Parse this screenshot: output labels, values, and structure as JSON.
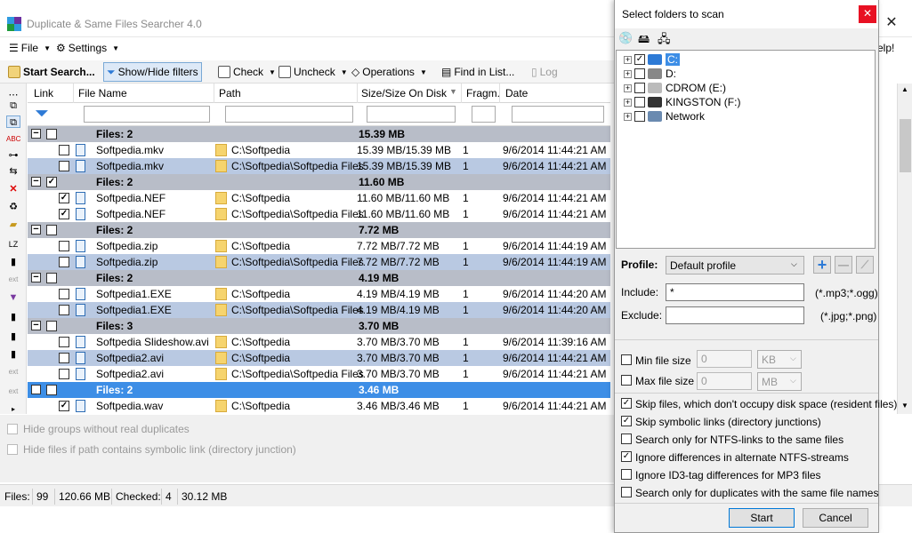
{
  "window": {
    "title": "Duplicate & Same Files Searcher 4.0",
    "close": "✕",
    "help_menu": "elp!"
  },
  "menu": {
    "file": "File",
    "settings": "Settings"
  },
  "toolbar": {
    "start_search": "Start Search...",
    "show_hide_filters": "Show/Hide filters",
    "check": "Check",
    "uncheck": "Uncheck",
    "operations": "Operations",
    "find_in_list": "Find in List...",
    "log": "Log"
  },
  "grid": {
    "headers": {
      "link": "Link",
      "file_name": "File Name",
      "path": "Path",
      "size": "Size/Size On Disk",
      "fragm": "Fragm.",
      "date": "Date"
    },
    "rows": [
      {
        "type": "group",
        "label": "Files: 2",
        "size": "15.39 MB",
        "checked": false
      },
      {
        "type": "file",
        "name": "Softpedia.mkv",
        "path": "C:\\Softpedia",
        "size": "15.39 MB/15.39 MB",
        "fragm": "1",
        "date": "9/6/2014 11:44:21 AM",
        "checked": false,
        "shade": "white"
      },
      {
        "type": "file",
        "name": "Softpedia.mkv",
        "path": "C:\\Softpedia\\Softpedia Files",
        "size": "15.39 MB/15.39 MB",
        "fragm": "1",
        "date": "9/6/2014 11:44:21 AM",
        "checked": false,
        "shade": "blue"
      },
      {
        "type": "group",
        "label": "Files: 2",
        "size": "11.60 MB",
        "checked": true
      },
      {
        "type": "file",
        "name": "Softpedia.NEF",
        "path": "C:\\Softpedia",
        "size": "11.60 MB/11.60 MB",
        "fragm": "1",
        "date": "9/6/2014 11:44:21 AM",
        "checked": true,
        "shade": "white"
      },
      {
        "type": "file",
        "name": "Softpedia.NEF",
        "path": "C:\\Softpedia\\Softpedia Files",
        "size": "11.60 MB/11.60 MB",
        "fragm": "1",
        "date": "9/6/2014 11:44:21 AM",
        "checked": true,
        "shade": "white"
      },
      {
        "type": "group",
        "label": "Files: 2",
        "size": "7.72 MB",
        "checked": false
      },
      {
        "type": "file",
        "name": "Softpedia.zip",
        "path": "C:\\Softpedia",
        "size": "7.72 MB/7.72 MB",
        "fragm": "1",
        "date": "9/6/2014 11:44:19 AM",
        "checked": false,
        "shade": "white"
      },
      {
        "type": "file",
        "name": "Softpedia.zip",
        "path": "C:\\Softpedia\\Softpedia Files",
        "size": "7.72 MB/7.72 MB",
        "fragm": "1",
        "date": "9/6/2014 11:44:19 AM",
        "checked": false,
        "shade": "blue"
      },
      {
        "type": "group",
        "label": "Files: 2",
        "size": "4.19 MB",
        "checked": false
      },
      {
        "type": "file",
        "name": "Softpedia1.EXE",
        "path": "C:\\Softpedia",
        "size": "4.19 MB/4.19 MB",
        "fragm": "1",
        "date": "9/6/2014 11:44:20 AM",
        "checked": false,
        "shade": "white"
      },
      {
        "type": "file",
        "name": "Softpedia1.EXE",
        "path": "C:\\Softpedia\\Softpedia Files",
        "size": "4.19 MB/4.19 MB",
        "fragm": "1",
        "date": "9/6/2014 11:44:20 AM",
        "checked": false,
        "shade": "blue"
      },
      {
        "type": "group",
        "label": "Files: 3",
        "size": "3.70 MB",
        "checked": false
      },
      {
        "type": "file",
        "name": "Softpedia Slideshow.avi",
        "path": "C:\\Softpedia",
        "size": "3.70 MB/3.70 MB",
        "fragm": "1",
        "date": "9/6/2014 11:39:16 AM",
        "checked": false,
        "shade": "white"
      },
      {
        "type": "file",
        "name": "Softpedia2.avi",
        "path": "C:\\Softpedia",
        "size": "3.70 MB/3.70 MB",
        "fragm": "1",
        "date": "9/6/2014 11:44:21 AM",
        "checked": false,
        "shade": "blue"
      },
      {
        "type": "file",
        "name": "Softpedia2.avi",
        "path": "C:\\Softpedia\\Softpedia Files",
        "size": "3.70 MB/3.70 MB",
        "fragm": "1",
        "date": "9/6/2014 11:44:21 AM",
        "checked": false,
        "shade": "white"
      },
      {
        "type": "group",
        "label": "Files: 2",
        "size": "3.46 MB",
        "checked": true,
        "selected": true
      },
      {
        "type": "file",
        "name": "Softpedia.wav",
        "path": "C:\\Softpedia",
        "size": "3.46 MB/3.46 MB",
        "fragm": "1",
        "date": "9/6/2014 11:44:21 AM",
        "checked": true,
        "shade": "white"
      }
    ]
  },
  "bottom_options": {
    "hide_groups": "Hide groups without real duplicates",
    "hide_symlink": "Hide files if path contains symbolic link (directory junction)"
  },
  "status": {
    "files_label": "Files:",
    "files_count": "99",
    "files_size": "120.66 MB",
    "checked_label": "Checked:",
    "checked_count": "4",
    "checked_size": "30.12 MB"
  },
  "dialog": {
    "title": "Select folders to scan",
    "tree": [
      {
        "label": "C:",
        "checked": true,
        "selected": true
      },
      {
        "label": "D:",
        "checked": false
      },
      {
        "label": "CDROM (E:)",
        "checked": false
      },
      {
        "label": "KINGSTON (F:)",
        "checked": false
      },
      {
        "label": "Network",
        "checked": false
      }
    ],
    "profile_label": "Profile:",
    "profile_value": "Default profile",
    "include_label": "Include:",
    "include_value": "*",
    "include_hint": "(*.mp3;*.ogg)",
    "exclude_label": "Exclude:",
    "exclude_value": "",
    "exclude_hint": "(*.jpg;*.png)",
    "min_size_label": "Min file size",
    "min_size_value": "0",
    "min_size_unit": "KB",
    "max_size_label": "Max file size",
    "max_size_value": "0",
    "max_size_unit": "MB",
    "options": [
      {
        "label": "Skip files, which don't occupy disk space (resident files)",
        "checked": true
      },
      {
        "label": "Skip symbolic links (directory junctions)",
        "checked": true
      },
      {
        "label": "Search only for NTFS-links to the same files",
        "checked": false
      },
      {
        "label": "Ignore differences in alternate NTFS-streams",
        "checked": true
      },
      {
        "label": "Ignore ID3-tag differences for MP3 files",
        "checked": false
      },
      {
        "label": "Search only for duplicates with the same file names",
        "checked": false
      }
    ],
    "start": "Start",
    "cancel": "Cancel"
  }
}
